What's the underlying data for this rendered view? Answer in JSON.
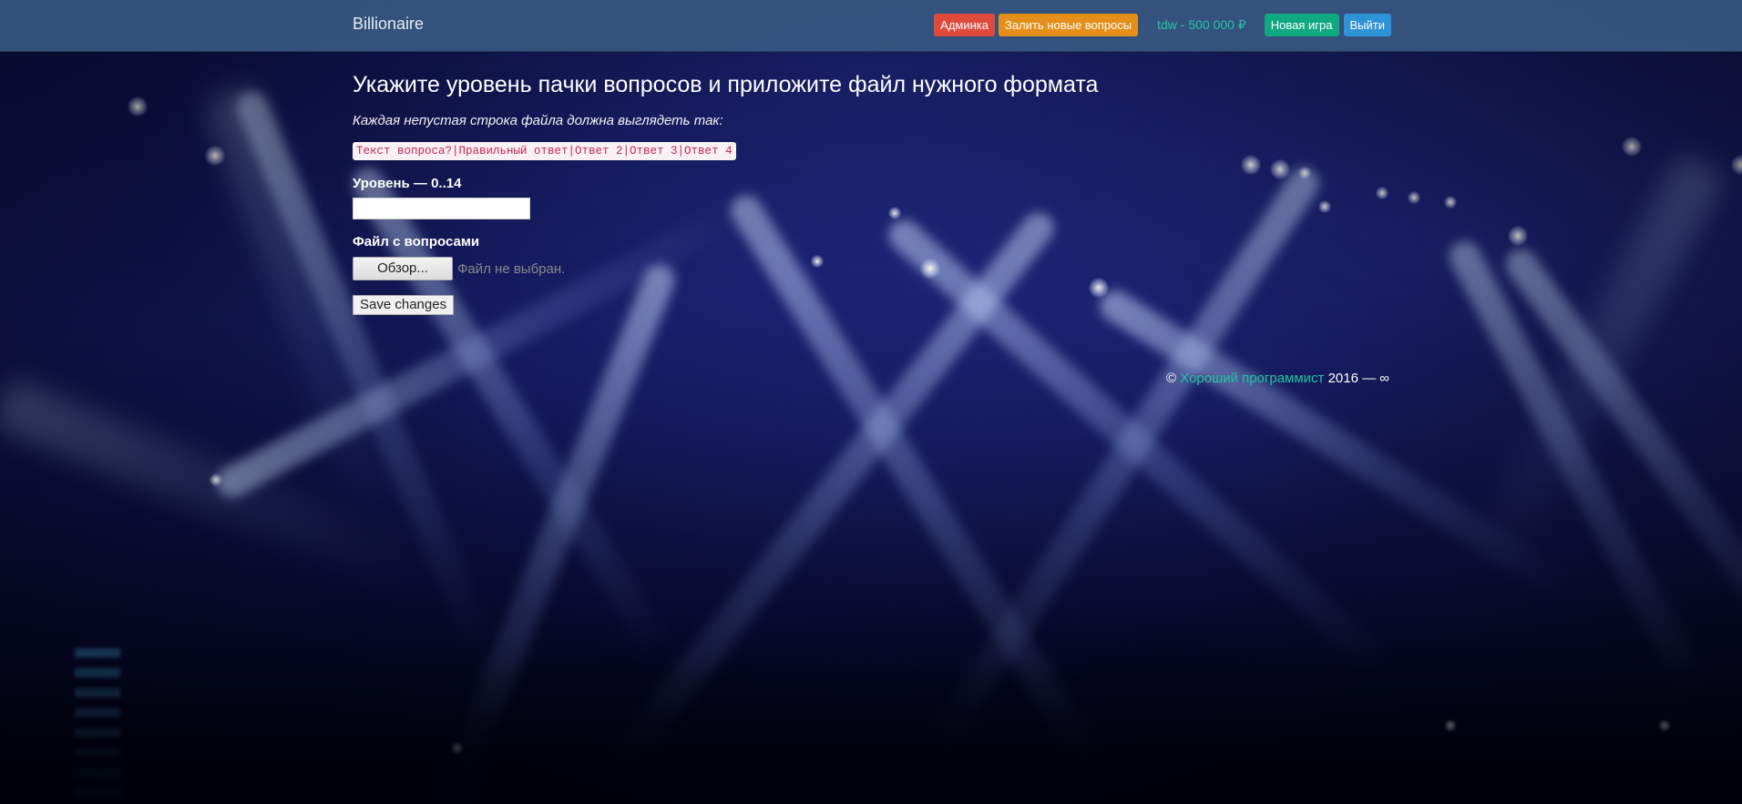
{
  "navbar": {
    "brand": "Billionaire",
    "admin_button": "Админка",
    "upload_button": "Залить новые вопросы",
    "user_balance": "tdw - 500 000 ₽",
    "new_game_button": "Новая игра",
    "logout_button": "Выйти"
  },
  "main": {
    "title": "Укажите уровень пачки вопросов и приложите файл нужного формата",
    "hint": "Каждая непустая строка файла должна выглядеть так:",
    "format_example": "Текст вопроса?|Правильный ответ|Ответ 2|Ответ 3|Ответ 4",
    "level_label": "Уровень — 0..14",
    "level_value": "",
    "file_label": "Файл с вопросами",
    "browse_button": "Обзор...",
    "file_status": "Файл не выбран.",
    "save_button": "Save changes"
  },
  "footer": {
    "copyright": "©",
    "author_link": "Хороший программист",
    "years": "2016 — ∞"
  },
  "colors": {
    "navbar": "#3a5b85",
    "danger": "#e04a3d",
    "warning": "#e58f1b",
    "success": "#10a880",
    "info": "#2f93d8",
    "accent": "#21c5a3",
    "code_text": "#c7254e"
  }
}
